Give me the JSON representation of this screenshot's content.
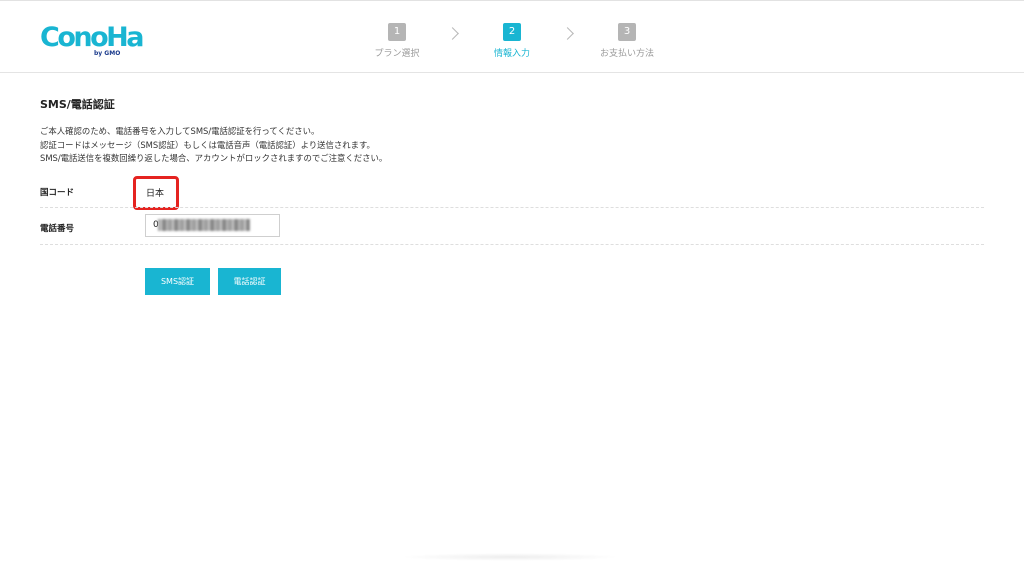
{
  "brand": {
    "logo_text": "ConoHa",
    "logo_sub": "by GMO",
    "color": "#19b5d2"
  },
  "steps": [
    {
      "number": "1",
      "label": "プラン選択",
      "active": false
    },
    {
      "number": "2",
      "label": "情報入力",
      "active": true
    },
    {
      "number": "3",
      "label": "お支払い方法",
      "active": false
    }
  ],
  "section": {
    "title": "SMS/電話認証",
    "description": [
      "ご本人確認のため、電話番号を入力してSMS/電話認証を行ってください。",
      "認証コードはメッセージ（SMS認証）もしくは電話音声（電話認証）より送信されます。",
      "SMS/電話送信を複数回繰り返した場合、アカウントがロックされますのでご注意ください。"
    ]
  },
  "form": {
    "country_label": "国コード",
    "country_value": "日本",
    "phone_label": "電話番号",
    "phone_value": "0"
  },
  "buttons": {
    "sms": "SMS認証",
    "voice": "電話認証"
  },
  "colors": {
    "accent": "#19b5d2",
    "highlight": "#e52320",
    "inactive_step": "#b5b5b5"
  }
}
